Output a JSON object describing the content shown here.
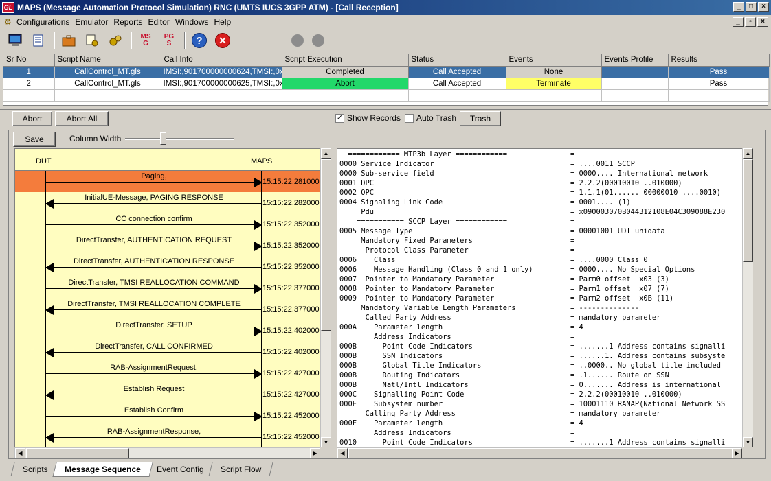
{
  "window": {
    "title": "MAPS (Message Automation Protocol Simulation) RNC (UMTS IUCS 3GPP ATM) - [Call Reception]",
    "logo_text": "GL"
  },
  "menu": [
    "Configurations",
    "Emulator",
    "Reports",
    "Editor",
    "Windows",
    "Help"
  ],
  "toolbar": {
    "msg_label_top": "MS",
    "msg_label_bottom": "G",
    "pgs_label_top": "PG",
    "pgs_label_bottom": "S",
    "help_label": "?",
    "stop_label": "✕"
  },
  "grid": {
    "columns": [
      "Sr No",
      "Script Name",
      "Call Info",
      "Script Execution",
      "Status",
      "Events",
      "Events Profile",
      "Results"
    ],
    "rows": [
      {
        "sr": "1",
        "script": "CallControl_MT.gls",
        "info": "IMSI:,901700000000624,TMSI:,0x...",
        "exec": "Completed",
        "status": "Call Accepted",
        "events": "None",
        "profile": "",
        "result": "Pass"
      },
      {
        "sr": "2",
        "script": "CallControl_MT.gls",
        "info": "IMSI:,901700000000625,TMSI:,0x...",
        "exec": "Abort",
        "status": "Call Accepted",
        "events": "Terminate",
        "profile": "",
        "result": "Pass"
      }
    ]
  },
  "controls": {
    "abort": "Abort",
    "abort_all": "Abort All",
    "show_records": "Show Records",
    "show_records_checked": "✓",
    "auto_trash": "Auto Trash",
    "trash": "Trash",
    "save": "Save",
    "column_width": "Column Width"
  },
  "sequence": {
    "left_entity": "DUT",
    "right_entity": "MAPS",
    "messages": [
      {
        "label": "Paging,",
        "dir": "right",
        "time": "15:15:22.281000",
        "highlight": true
      },
      {
        "label": "InitialUE-Message, PAGING RESPONSE",
        "dir": "left",
        "time": "15:15:22.282000",
        "highlight": false
      },
      {
        "label": "CC connection confirm",
        "dir": "right",
        "time": "15:15:22.352000",
        "highlight": false
      },
      {
        "label": "DirectTransfer, AUTHENTICATION REQUEST",
        "dir": "right",
        "time": "15:15:22.352000",
        "highlight": false
      },
      {
        "label": "DirectTransfer, AUTHENTICATION RESPONSE",
        "dir": "left",
        "time": "15:15:22.352000",
        "highlight": false
      },
      {
        "label": "DirectTransfer, TMSI REALLOCATION COMMAND",
        "dir": "right",
        "time": "15:15:22.377000",
        "highlight": false
      },
      {
        "label": "DirectTransfer, TMSI REALLOCATION COMPLETE",
        "dir": "left",
        "time": "15:15:22.377000",
        "highlight": false
      },
      {
        "label": "DirectTransfer, SETUP",
        "dir": "right",
        "time": "15:15:22.402000",
        "highlight": false
      },
      {
        "label": "DirectTransfer, CALL CONFIRMED",
        "dir": "left",
        "time": "15:15:22.402000",
        "highlight": false
      },
      {
        "label": "RAB-AssignmentRequest,",
        "dir": "right",
        "time": "15:15:22.427000",
        "highlight": false
      },
      {
        "label": "Establish Request",
        "dir": "left",
        "time": "15:15:22.427000",
        "highlight": false
      },
      {
        "label": "Establish Confirm",
        "dir": "right",
        "time": "15:15:22.452000",
        "highlight": false
      },
      {
        "label": "RAB-AssignmentResponse,",
        "dir": "left",
        "time": "15:15:22.452000",
        "highlight": false
      }
    ]
  },
  "detail": {
    "lines": [
      {
        "left": "  ============ MTP3b Layer ============",
        "right": "="
      },
      {
        "left": "0000 Service Indicator",
        "right": "= ....0011 SCCP"
      },
      {
        "left": "0000 Sub-service field",
        "right": "= 0000.... International network"
      },
      {
        "left": "0001 DPC",
        "right": "= 2.2.2(00010010 ..010000)"
      },
      {
        "left": "0002 OPC",
        "right": "= 1.1.1(01...... 00000010 ....0010)"
      },
      {
        "left": "0004 Signaling Link Code",
        "right": "= 0001.... (1)"
      },
      {
        "left": "     Pdu",
        "right": "= x090003070B044312108E04C309088E230"
      },
      {
        "left": "    =========== SCCP Layer ============",
        "right": "="
      },
      {
        "left": "0005 Message Type",
        "right": "= 00001001 UDT unidata"
      },
      {
        "left": "     Mandatory Fixed Parameters",
        "right": "="
      },
      {
        "left": "      Protocol Class Parameter",
        "right": "="
      },
      {
        "left": "0006    Class",
        "right": "= ....0000 Class 0"
      },
      {
        "left": "0006    Message Handling (Class 0 and 1 only)",
        "right": "= 0000.... No Special Options"
      },
      {
        "left": "0007  Pointer to Mandatory Parameter",
        "right": "= Parm0 offset  x03 (3)"
      },
      {
        "left": "0008  Pointer to Mandatory Parameter",
        "right": "= Parm1 offset  x07 (7)"
      },
      {
        "left": "0009  Pointer to Mandatory Parameter",
        "right": "= Parm2 offset  x0B (11)"
      },
      {
        "left": "     Mandatory Variable Length Parameters",
        "right": "= --------------"
      },
      {
        "left": "      Called Party Address",
        "right": "= mandatory parameter"
      },
      {
        "left": "000A    Parameter length",
        "right": "= 4"
      },
      {
        "left": "        Address Indicators",
        "right": "="
      },
      {
        "left": "000B      Point Code Indicators",
        "right": "= .......1 Address contains signalli"
      },
      {
        "left": "000B      SSN Indicators",
        "right": "= ......1. Address contains subsyste"
      },
      {
        "left": "000B      Global Title Indicators",
        "right": "= ..0000.. No global title included"
      },
      {
        "left": "000B      Routing Indicators",
        "right": "= .1...... Route on SSN"
      },
      {
        "left": "000B      Natl/Intl Indicators",
        "right": "= 0....... Address is international"
      },
      {
        "left": "000C    Signalling Point Code",
        "right": "= 2.2.2(00010010 ..010000)"
      },
      {
        "left": "000E    Subsystem number",
        "right": "= 10001110 RANAP(National Network SS"
      },
      {
        "left": "      Calling Party Address",
        "right": "= mandatory parameter"
      },
      {
        "left": "000F    Parameter length",
        "right": "= 4"
      },
      {
        "left": "        Address Indicators",
        "right": "="
      },
      {
        "left": "0010      Point Code Indicators",
        "right": "= .......1 Address contains signalli"
      }
    ]
  },
  "tabs": [
    "Scripts",
    "Message Sequence",
    "Event Config",
    "Script Flow"
  ],
  "active_tab": "Message Sequence"
}
